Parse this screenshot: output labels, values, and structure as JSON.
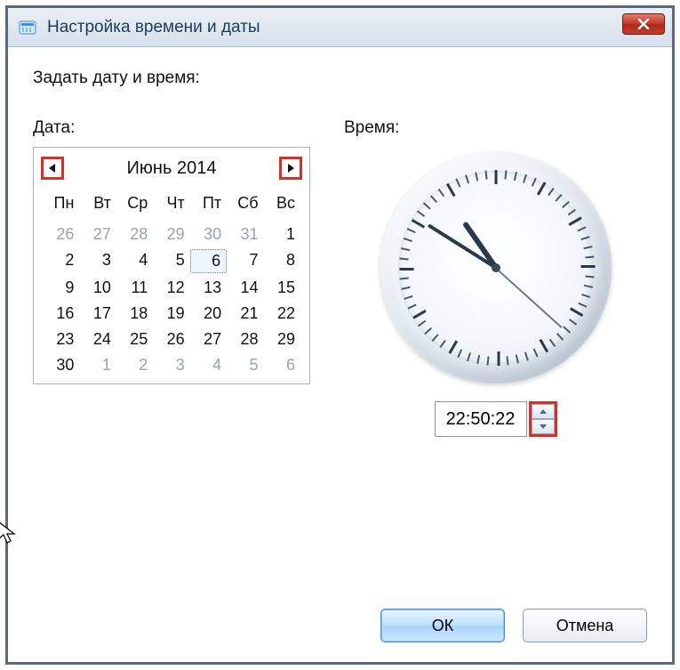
{
  "window": {
    "title": "Настройка времени и даты"
  },
  "prompt": "Задать дату и время:",
  "date": {
    "label": "Дата:",
    "month_title": "Июнь 2014",
    "weekdays": [
      "Пн",
      "Вт",
      "Ср",
      "Чт",
      "Пт",
      "Сб",
      "Вс"
    ],
    "grid": [
      {
        "n": "26",
        "other": true
      },
      {
        "n": "27",
        "other": true
      },
      {
        "n": "28",
        "other": true
      },
      {
        "n": "29",
        "other": true
      },
      {
        "n": "30",
        "other": true
      },
      {
        "n": "31",
        "other": true
      },
      {
        "n": "1"
      },
      {
        "n": "2"
      },
      {
        "n": "3"
      },
      {
        "n": "4"
      },
      {
        "n": "5"
      },
      {
        "n": "6",
        "selected": true
      },
      {
        "n": "7"
      },
      {
        "n": "8"
      },
      {
        "n": "9"
      },
      {
        "n": "10"
      },
      {
        "n": "11"
      },
      {
        "n": "12"
      },
      {
        "n": "13"
      },
      {
        "n": "14"
      },
      {
        "n": "15"
      },
      {
        "n": "16"
      },
      {
        "n": "17"
      },
      {
        "n": "18"
      },
      {
        "n": "19"
      },
      {
        "n": "20"
      },
      {
        "n": "21"
      },
      {
        "n": "22"
      },
      {
        "n": "23"
      },
      {
        "n": "24"
      },
      {
        "n": "25"
      },
      {
        "n": "26"
      },
      {
        "n": "27"
      },
      {
        "n": "28"
      },
      {
        "n": "29"
      },
      {
        "n": "30"
      },
      {
        "n": "1",
        "other": true
      },
      {
        "n": "2",
        "other": true
      },
      {
        "n": "3",
        "other": true
      },
      {
        "n": "4",
        "other": true
      },
      {
        "n": "5",
        "other": true
      },
      {
        "n": "6",
        "other": true
      }
    ]
  },
  "time": {
    "label": "Время:",
    "value": "22:50:22",
    "hour": 22,
    "minute": 50,
    "second": 22
  },
  "buttons": {
    "ok": "ОК",
    "cancel": "Отмена"
  },
  "highlight_color": "#d93025"
}
